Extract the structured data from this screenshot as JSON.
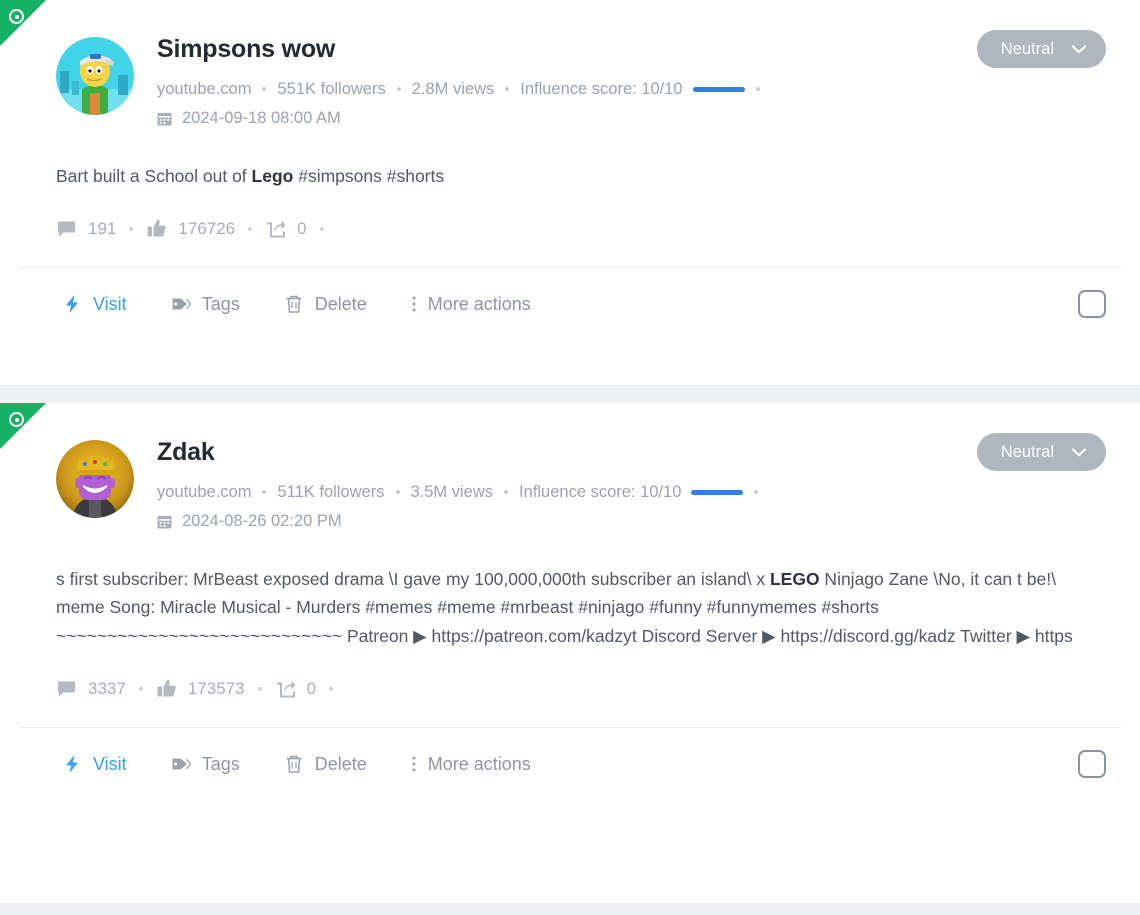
{
  "cards": [
    {
      "ribbon_icon": "eye-icon",
      "account_name": "Simpsons wow",
      "source": "youtube.com",
      "followers": "551K followers",
      "views": "2.8M views",
      "influence": "Influence score: 10/10",
      "date": "2024-09-18 08:00 AM",
      "sentiment": "Neutral",
      "text_before": "Bart built a School out of ",
      "text_bold": "Lego",
      "text_after": " #simpsons #shorts",
      "comments": "191",
      "likes": "176726",
      "shares": "0",
      "actions": {
        "visit": "Visit",
        "tags": "Tags",
        "delete": "Delete",
        "more": "More actions"
      }
    },
    {
      "ribbon_icon": "eye-icon",
      "account_name": "Zdak",
      "source": "youtube.com",
      "followers": "511K followers",
      "views": "3.5M views",
      "influence": "Influence score: 10/10",
      "date": "2024-08-26 02:20 PM",
      "sentiment": "Neutral",
      "text_before": "s first subscriber: MrBeast exposed drama \\I gave my 100,000,000th subscriber an island\\ x ",
      "text_bold": "LEGO",
      "text_after": " Ninjago Zane \\No, it can t be!\\ meme Song: Miracle Musical - Murders #memes #meme #mrbeast #ninjago #funny #funnymemes #shorts ~~~~~~~~~~~~~~~~~~~~~~~~~~~~ Patreon ▶ https://patreon.com/kadzyt Discord Server ▶ https://discord.gg/kadz Twitter ▶ https",
      "comments": "3337",
      "likes": "173573",
      "shares": "0",
      "actions": {
        "visit": "Visit",
        "tags": "Tags",
        "delete": "Delete",
        "more": "More actions"
      }
    }
  ],
  "colors": {
    "ribbon_green": "#16b263",
    "influence_blue": "#2f7fe4",
    "visit_blue": "#3aa0f5",
    "sentiment_gray": "#aeb6bf",
    "page_bg": "#eef0f2"
  }
}
